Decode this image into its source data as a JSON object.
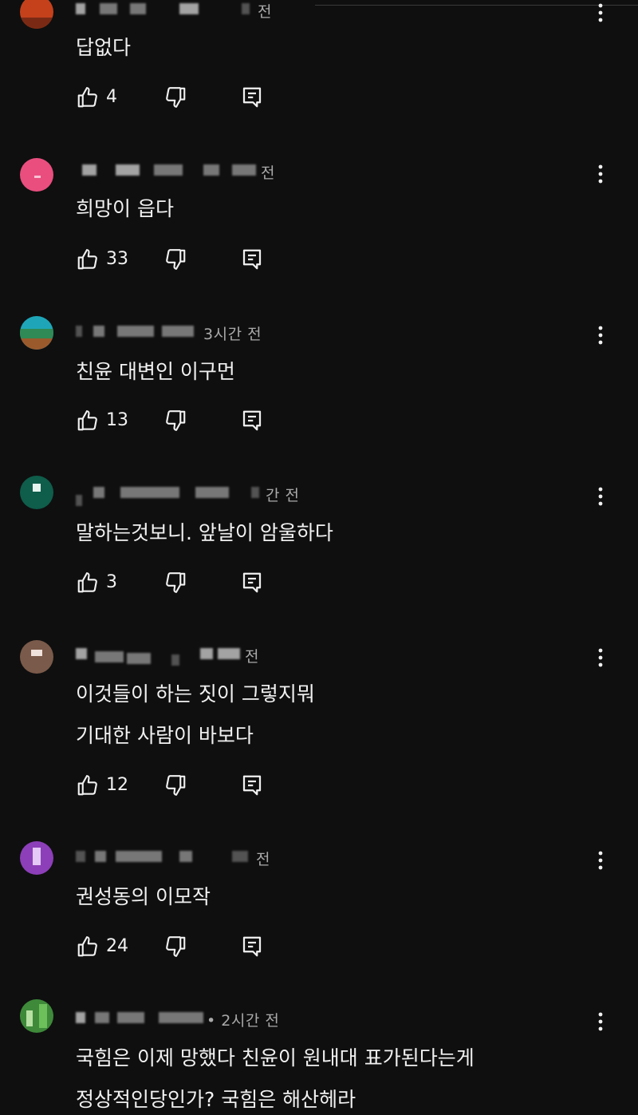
{
  "colors": {
    "background": "#0f0f0f",
    "text_primary": "#f1f1f1",
    "text_secondary": "#aaaaaa"
  },
  "icons": {
    "like": "thumb-up-icon",
    "dislike": "thumb-down-icon",
    "reply": "reply-comment-icon",
    "more": "more-vert-icon"
  },
  "comments": [
    {
      "time": "전",
      "lines": [
        "답없다"
      ],
      "likes": "4"
    },
    {
      "time": "전",
      "lines": [
        "희망이 읍다"
      ],
      "likes": "33"
    },
    {
      "time": "3시간 전",
      "lines": [
        "친윤 대변인 이구먼"
      ],
      "likes": "13"
    },
    {
      "time": "간 전",
      "lines": [
        "말하는것보니. 앞날이 암울하다"
      ],
      "likes": "3"
    },
    {
      "time": "전",
      "lines": [
        "이것들이 하는 짓이 그렇지뭐",
        "기대한 사람이 바보다"
      ],
      "likes": "12"
    },
    {
      "time": "전",
      "lines": [
        "권성동의 이모작"
      ],
      "likes": "24"
    },
    {
      "time": "• 2시간 전",
      "lines": [
        "국힘은 이제 망했다 친윤이 원내대 표가된다는게",
        "정상적인당인가? 국힘은 해산헤라"
      ],
      "likes": ""
    }
  ]
}
